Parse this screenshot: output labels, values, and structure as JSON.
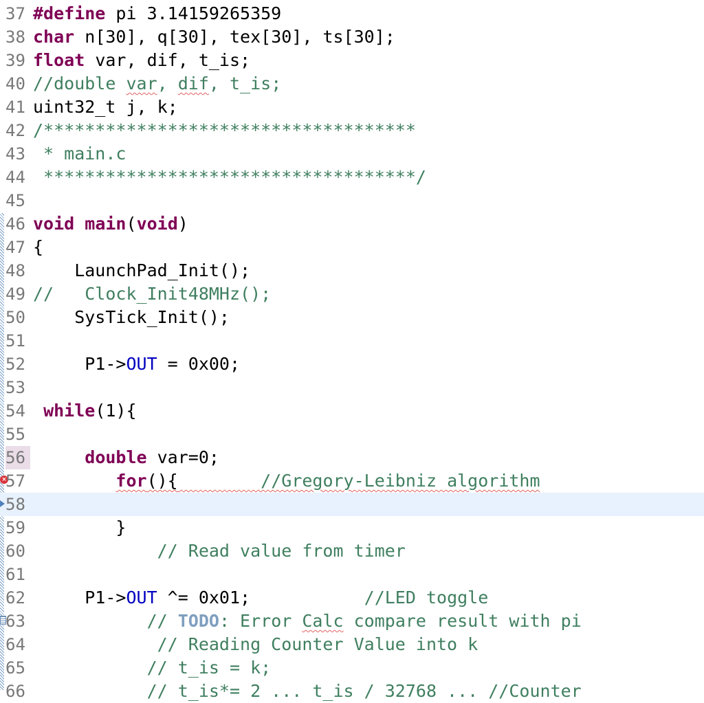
{
  "editor": {
    "lines": [
      {
        "num": "37",
        "parts": [
          {
            "t": "#define",
            "c": "kw"
          },
          {
            "t": " pi 3.14159265359"
          }
        ]
      },
      {
        "num": "38",
        "parts": [
          {
            "t": "char",
            "c": "kw"
          },
          {
            "t": " n[30], q[30], tex[30], ts[30];"
          }
        ]
      },
      {
        "num": "39",
        "parts": [
          {
            "t": "float",
            "c": "kw"
          },
          {
            "t": " var, dif, t_is;"
          }
        ]
      },
      {
        "num": "40",
        "parts": [
          {
            "t": "//double ",
            "c": "cm"
          },
          {
            "t": "var",
            "c": "cm sq"
          },
          {
            "t": ", ",
            "c": "cm"
          },
          {
            "t": "dif",
            "c": "cm sq"
          },
          {
            "t": ", t_is;",
            "c": "cm"
          }
        ]
      },
      {
        "num": "41",
        "parts": [
          {
            "t": "uint32_t j, k;"
          }
        ]
      },
      {
        "num": "42",
        "parts": [
          {
            "t": "/************************************",
            "c": "cm"
          }
        ]
      },
      {
        "num": "43",
        "parts": [
          {
            "t": " * main.c",
            "c": "cm"
          }
        ]
      },
      {
        "num": "44",
        "parts": [
          {
            "t": " ************************************/",
            "c": "cm"
          }
        ]
      },
      {
        "num": "45",
        "parts": []
      },
      {
        "num": "46",
        "parts": [
          {
            "t": "void",
            "c": "kw"
          },
          {
            "t": " "
          },
          {
            "t": "main",
            "c": "kw"
          },
          {
            "t": "("
          },
          {
            "t": "void",
            "c": "kw"
          },
          {
            "t": ")"
          }
        ]
      },
      {
        "num": "47",
        "parts": [
          {
            "t": "{"
          }
        ]
      },
      {
        "num": "48",
        "parts": [
          {
            "t": "    LaunchPad_Init();"
          }
        ]
      },
      {
        "num": "49",
        "parts": [
          {
            "t": "//   Clock_Init48MHz();",
            "c": "cm"
          }
        ]
      },
      {
        "num": "50",
        "parts": [
          {
            "t": "    SysTick_Init();"
          }
        ]
      },
      {
        "num": "51",
        "parts": []
      },
      {
        "num": "52",
        "parts": [
          {
            "t": "     P1->"
          },
          {
            "t": "OUT",
            "c": "fld"
          },
          {
            "t": " = 0x00;"
          }
        ]
      },
      {
        "num": "53",
        "parts": []
      },
      {
        "num": "54",
        "parts": [
          {
            "t": " "
          },
          {
            "t": "while",
            "c": "kw"
          },
          {
            "t": "(1){"
          }
        ]
      },
      {
        "num": "55",
        "parts": []
      },
      {
        "num": "56",
        "parts": [
          {
            "t": "     "
          },
          {
            "t": "double",
            "c": "kw"
          },
          {
            "t": " var=0;"
          }
        ]
      },
      {
        "num": "57",
        "parts": [
          {
            "t": "        "
          },
          {
            "t": "for",
            "c": "kw sq"
          },
          {
            "t": "(){",
            "c": "sq"
          },
          {
            "t": "        //Gregory-Leibniz algorithm",
            "c": "cm sq"
          }
        ]
      },
      {
        "num": "58",
        "parts": []
      },
      {
        "num": "59",
        "parts": [
          {
            "t": "        }"
          }
        ]
      },
      {
        "num": "60",
        "parts": [
          {
            "t": "            // Read value from timer",
            "c": "cm"
          }
        ]
      },
      {
        "num": "61",
        "parts": []
      },
      {
        "num": "62",
        "parts": [
          {
            "t": "     P1->"
          },
          {
            "t": "OUT",
            "c": "fld"
          },
          {
            "t": " ^= 0x01;           "
          },
          {
            "t": "//LED toggle",
            "c": "cm"
          }
        ]
      },
      {
        "num": "63",
        "parts": [
          {
            "t": "           // ",
            "c": "cm"
          },
          {
            "t": "TODO",
            "c": "todo"
          },
          {
            "t": ": Error ",
            "c": "cm"
          },
          {
            "t": "Calc",
            "c": "cm sq"
          },
          {
            "t": " compare result with pi",
            "c": "cm"
          }
        ]
      },
      {
        "num": "64",
        "parts": [
          {
            "t": "            // Reading Counter Value into k",
            "c": "cm"
          }
        ]
      },
      {
        "num": "65",
        "parts": [
          {
            "t": "           // t_is = k;",
            "c": "cm"
          }
        ]
      },
      {
        "num": "66",
        "parts": [
          {
            "t": "           // t_is*= 2 ... t_is / 32768 ... //Counter",
            "c": "cm"
          }
        ]
      }
    ],
    "current_line": "58",
    "highlighted_gutter_line": "56",
    "error_line": "57",
    "pointer_line": "58",
    "task_line": "63",
    "colors": {
      "keyword": "#7f0055",
      "comment": "#3f7f5f",
      "field": "#0000c0",
      "todo": "#7f9fbf",
      "line_number": "#787878",
      "current_line_bg": "#e8f2fe"
    }
  }
}
